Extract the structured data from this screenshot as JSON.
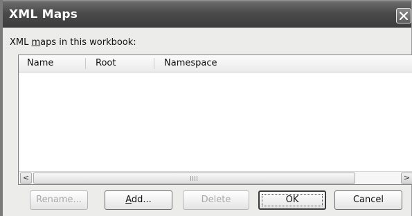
{
  "window": {
    "title": "XML Maps",
    "close_icon": "close-icon"
  },
  "caption": {
    "prefix": "XML ",
    "accel": "m",
    "suffix": "aps in this workbook:"
  },
  "table": {
    "columns": [
      "Name",
      "Root",
      "Namespace"
    ],
    "rows": []
  },
  "scrollbar": {
    "left_arrow": "<",
    "right_arrow": ">"
  },
  "buttons": {
    "rename": "Rename...",
    "add_accel": "A",
    "add_rest": "dd...",
    "delete": "Delete",
    "ok": "OK",
    "cancel": "Cancel"
  },
  "colors": {
    "titlebar": "#4a4a4a",
    "dialog_bg": "#ececea",
    "disabled_text": "#a9a9a9"
  }
}
